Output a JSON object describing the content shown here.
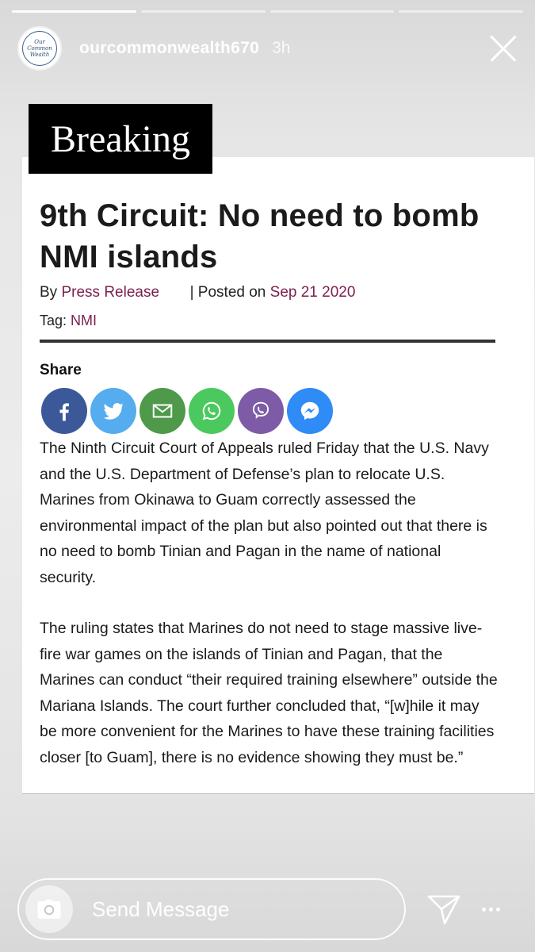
{
  "story": {
    "progress_segments": 4,
    "active_segments": 1,
    "username": "ourcommonwealth670",
    "time_ago": "3h",
    "avatar_text": "Our Common Wealth"
  },
  "article": {
    "badge": "Breaking",
    "headline": "9th Circuit: No need to bomb NMI islands",
    "by_prefix": "By",
    "author": "Press Release",
    "posted_prefix": "| Posted on",
    "date": "Sep 21 2020",
    "tag_prefix": "Tag:",
    "tag": "NMI",
    "share_label": "Share",
    "share_buttons": [
      {
        "name": "facebook",
        "color": "#3b5998"
      },
      {
        "name": "twitter",
        "color": "#55acee"
      },
      {
        "name": "email",
        "color": "#4e9a4a"
      },
      {
        "name": "whatsapp",
        "color": "#4cc95e"
      },
      {
        "name": "viber",
        "color": "#7d5ba6"
      },
      {
        "name": "messenger",
        "color": "#2f8bf5"
      }
    ],
    "paragraphs": [
      "The Ninth Circuit Court of Appeals ruled Friday that the U.S. Navy and the U.S. Department of Defense’s plan to relocate U.S. Marines from Okinawa to Guam correctly assessed the environmental impact of the plan but also pointed out that there is no need to bomb Tinian and Pagan in the name of national security.",
      "The ruling states that Marines do not need to stage massive live-fire war games on the islands of Tinian and Pagan, that the Marines can conduct “their required training elsewhere” outside the Mariana Islands. The court further concluded that, “[w]hile it may be more convenient for the Marines to have these training facilities closer [to Guam], there is no evidence showing they must be.”"
    ]
  },
  "footer": {
    "message_placeholder": "Send Message"
  }
}
